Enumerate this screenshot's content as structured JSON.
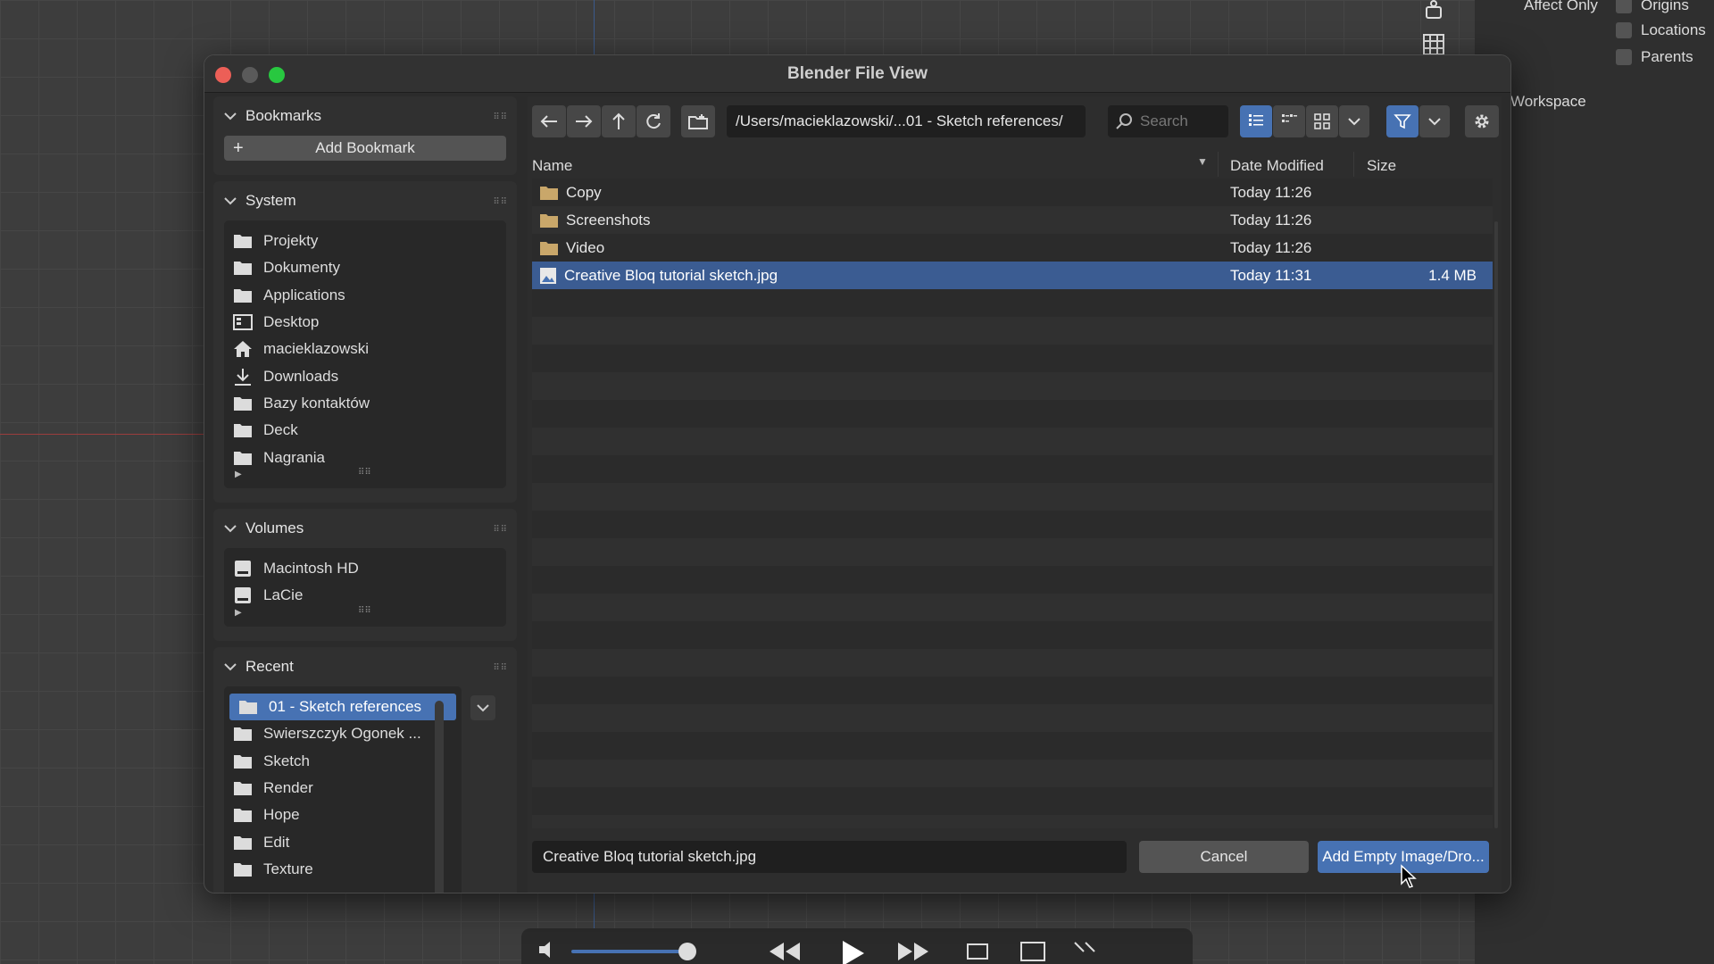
{
  "background": {
    "right_panel": {
      "affect_only": "Affect Only",
      "origins": "Origins",
      "locations": "Locations",
      "parents": "Parents",
      "workspace": "Workspace"
    }
  },
  "dialog": {
    "title": "Blender File View",
    "bookmarks": {
      "header": "Bookmarks",
      "add_label": "Add Bookmark"
    },
    "system": {
      "header": "System",
      "items": [
        {
          "label": "Projekty",
          "icon": "folder-icon"
        },
        {
          "label": "Dokumenty",
          "icon": "folder-icon"
        },
        {
          "label": "Applications",
          "icon": "folder-icon"
        },
        {
          "label": "Desktop",
          "icon": "desktop-icon"
        },
        {
          "label": "macieklazowski",
          "icon": "home-icon"
        },
        {
          "label": "Downloads",
          "icon": "download-icon"
        },
        {
          "label": "Bazy kontaktów",
          "icon": "folder-icon"
        },
        {
          "label": "Deck",
          "icon": "folder-icon"
        },
        {
          "label": "Nagrania",
          "icon": "folder-icon"
        }
      ]
    },
    "volumes": {
      "header": "Volumes",
      "items": [
        {
          "label": "Macintosh HD"
        },
        {
          "label": "LaCie"
        }
      ]
    },
    "recent": {
      "header": "Recent",
      "items": [
        {
          "label": "01 - Sketch references",
          "selected": true
        },
        {
          "label": "Swierszczyk Ogonek ..."
        },
        {
          "label": "Sketch"
        },
        {
          "label": "Render"
        },
        {
          "label": "Hope"
        },
        {
          "label": "Edit"
        },
        {
          "label": "Texture"
        }
      ]
    },
    "path": "/Users/macieklazowski/...01 - Sketch references/",
    "search_placeholder": "Search",
    "columns": {
      "name": "Name",
      "date": "Date Modified",
      "size": "Size"
    },
    "files": [
      {
        "name": "Copy",
        "type": "folder",
        "date": "Today 11:26",
        "size": ""
      },
      {
        "name": "Screenshots",
        "type": "folder",
        "date": "Today 11:26",
        "size": ""
      },
      {
        "name": "Video",
        "type": "folder",
        "date": "Today 11:26",
        "size": ""
      },
      {
        "name": "Creative Bloq tutorial sketch.jpg",
        "type": "image",
        "date": "Today 11:31",
        "size": "1.4 MB",
        "selected": true
      }
    ],
    "filename": "Creative Bloq tutorial sketch.jpg",
    "cancel_label": "Cancel",
    "confirm_label": "Add Empty Image/Dro...",
    "colors": {
      "accent": "#4772b3",
      "selection": "#3b5c92",
      "close": "#ec5f57",
      "minimize": "#5a5a5a",
      "zoom": "#28c840"
    }
  }
}
